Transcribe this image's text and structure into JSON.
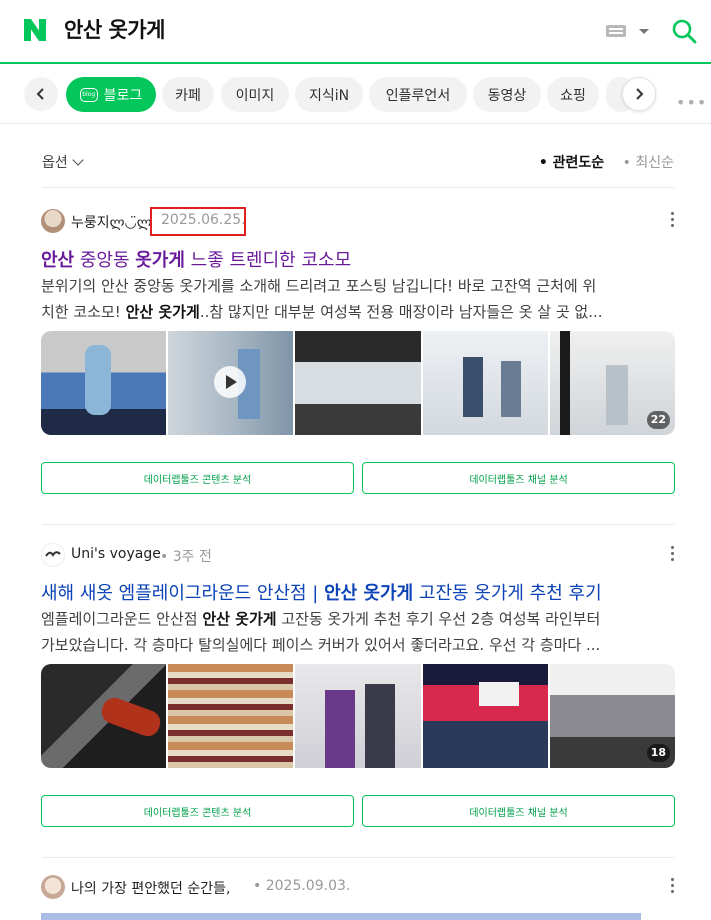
{
  "header": {
    "query": "안산 옷가게",
    "logo_text": "N"
  },
  "tabs": [
    {
      "label": "블로그",
      "badge": "blog"
    },
    {
      "label": "카페"
    },
    {
      "label": "이미지"
    },
    {
      "label": "지식iN"
    },
    {
      "label": "인플루언서"
    },
    {
      "label": "동영상"
    },
    {
      "label": "쇼핑"
    }
  ],
  "options": {
    "label": "옵션",
    "sort_active": "• 관련도순",
    "sort_inactive": "• 최신순"
  },
  "posts": [
    {
      "author": "누룽지ლ◡̈ლ",
      "date": "2025.06.25.",
      "title": {
        "p1": "안산",
        "p2": " 중앙동 ",
        "p3": "옷가게",
        "p4": " 느좋 트렌디한 코소모"
      },
      "desc1": {
        "a": "분위기의 안산 중앙동 옷가게를 소개해 드리려고 포스팅 남깁니다! 바로 고잔역 근처에 위"
      },
      "desc2": {
        "a": "치한 코소모! ",
        "b": "안산 옷가게",
        "c": "..참 많지만 대부분 여성복 전용 매장이라 남자들은 옷 살 곳 없..."
      },
      "image_count": "22",
      "btn_content": "데이터랩툴즈 콘텐츠 분석",
      "btn_channel": "데이터랩툴즈 채널 분석"
    },
    {
      "author": "Uni's voyage",
      "date": "3주 전",
      "title": {
        "p1": "새해 새옷 엠플레이그라운드 안산점 | ",
        "p2": "안산 옷가게",
        "p3": " 고잔동 옷가게 추천 후기"
      },
      "desc1": {
        "a": "엠플레이그라운드 안산점 ",
        "b": "안산 옷가게",
        "c": " 고잔동 옷가게 추천 후기 우선 2층 여성복 라인부터"
      },
      "desc2": {
        "a": "가보았습니다. 각 층마다 탈의실에다 페이스 커버가 있어서 좋더라고요. 우선 각 층마다 ..."
      },
      "image_count": "18",
      "btn_content": "데이터랩툴즈 콘텐츠 분석",
      "btn_channel": "데이터랩툴즈 채널 분석"
    },
    {
      "author": "나의 가장 편안했던 순간들,",
      "date": "2025.09.03."
    }
  ],
  "colors": {
    "brand": "#03c75a",
    "visited_title": "#6a1b9a",
    "title": "#0c43b7",
    "highlight": "#e02020"
  }
}
